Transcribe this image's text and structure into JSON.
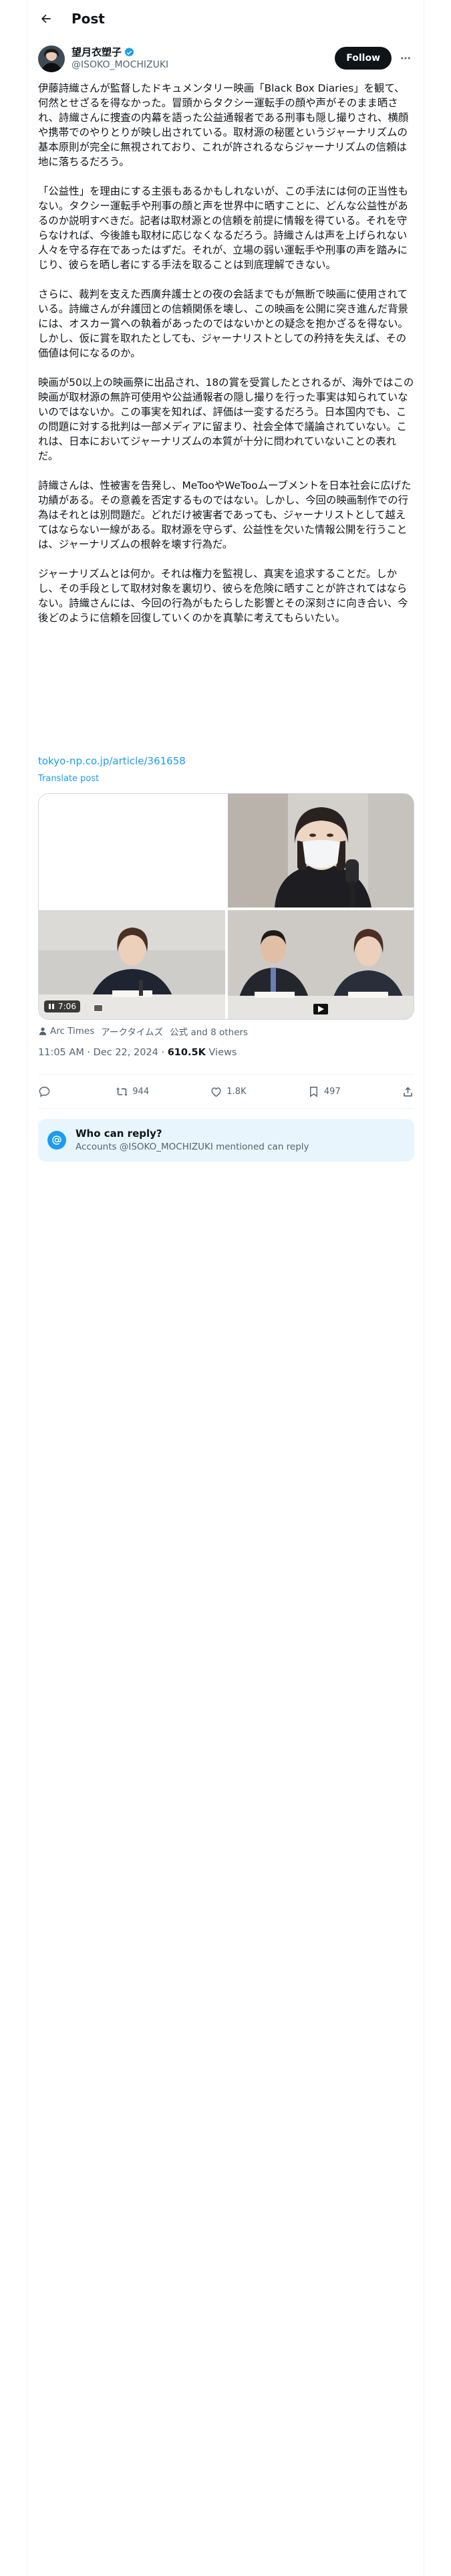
{
  "header": {
    "title": "Post"
  },
  "author": {
    "name": "望月衣塑子",
    "handle": "@ISOKO_MOCHIZUKI",
    "follow_label": "Follow"
  },
  "tweet": {
    "paragraphs": [
      "伊藤詩織さんが監督したドキュメンタリー映画「Black Box Diaries」を観て、何然とせざるを得なかった。冒頭からタクシー運転手の顔や声がそのまま晒され、詩織さんに捜査の内幕を語った公益通報者である刑事も隠し撮りされ、横顔や携帯でのやりとりが映し出されている。取材源の秘匿というジャーナリズムの基本原則が完全に無視されており、これが許されるならジャーナリズムの信頼は地に落ちるだろう。",
      "「公益性」を理由にする主張もあるかもしれないが、この手法には何の正当性もない。タクシー運転手や刑事の顔と声を世界中に晒すことに、どんな公益性があるのか説明すべきだ。記者は取材源との信頼を前提に情報を得ている。それを守らなければ、今後誰も取材に応じなくなるだろう。詩織さんは声を上げられない人々を守る存在であったはずだ。それが、立場の弱い運転手や刑事の声を踏みにじり、彼らを晒し者にする手法を取ることは到底理解できない。",
      "さらに、裁判を支えた西廣弁護士との夜の会話までもが無断で映画に使用されている。詩織さんが弁護団との信頼関係を壊し、この映画を公開に突き進んだ背景には、オスカー賞への執着があったのではないかとの疑念を抱かざるを得ない。しかし、仮に賞を取れたとしても、ジャーナリストとしての矜持を失えば、その価値は何になるのか。",
      "映画が50以上の映画祭に出品され、18の賞を受賞したとされるが、海外ではこの映画が取材源の無許可使用や公益通報者の隠し撮りを行った事実は知られていないのではないか。この事実を知れば、評価は一変するだろう。日本国内でも、この問題に対する批判は一部メディアに留まり、社会全体で議論されていない。これは、日本においてジャーナリズムの本質が十分に問われていないことの表れだ。",
      "詩織さんは、性被害を告発し、MeTooやWeTooムーブメントを日本社会に広げた功績がある。その意義を否定するものではない。しかし、今回の映画制作での行為はそれとは別問題だ。どれだけ被害者であっても、ジャーナリストとして越えてはならない一線がある。取材源を守らず、公益性を欠いた情報公開を行うことは、ジャーナリズムの根幹を壊す行為だ。",
      "ジャーナリズムとは何か。それは権力を監視し、真実を追求することだ。しかし、その手段として取材対象を裏切り、彼らを危険に晒すことが許されてはならない。詩織さんには、今回の行為がもたらした影響とその深刻さに向き合い、今後どのように信頼を回復していくのかを真摯に考えてもらいたい。"
    ],
    "link": "tokyo-np.co.jp/article/361658",
    "translate": "Translate post"
  },
  "media": {
    "video_time": "7:06"
  },
  "tags": [
    "Arc Times",
    "アークタイムズ",
    "公式 and 8 others"
  ],
  "meta": {
    "time": "11:05 AM · Dec 22, 2024 · ",
    "views_count": "610.5K",
    "views_label": " Views"
  },
  "actions": {
    "reply": "",
    "repost": "944",
    "like": "1.8K",
    "bookmark": "497"
  },
  "reply_restriction": {
    "title": "Who can reply?",
    "subtitle": "Accounts @ISOKO_MOCHIZUKI mentioned can reply"
  },
  "colors": {
    "accent": "#1d9bf0",
    "text": "#0f1419",
    "muted": "#536471",
    "follow_bg": "#0f1419",
    "reply_bg": "#e8f5fd"
  }
}
